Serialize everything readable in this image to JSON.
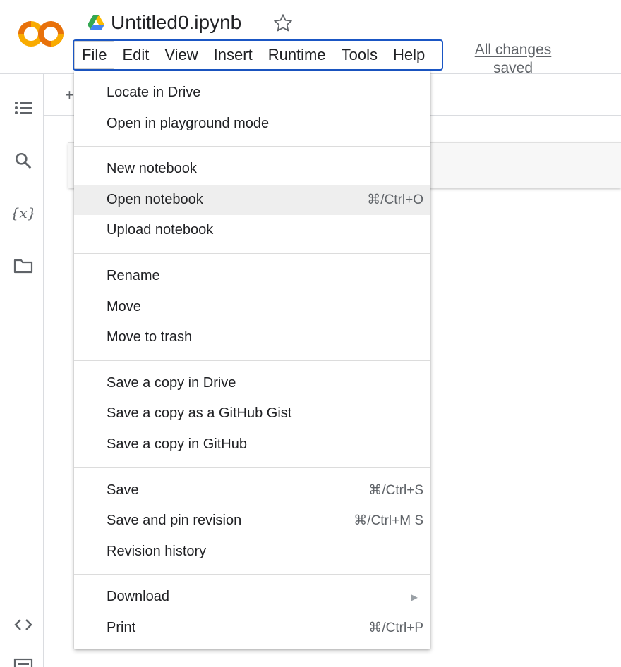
{
  "header": {
    "title": "Untitled0.ipynb",
    "save_status_line1": "All changes",
    "save_status_line2": "saved",
    "logo": {
      "text": "CO",
      "color_left": "#f9ab00",
      "color_right": "#e8710a"
    }
  },
  "menubar": {
    "items": [
      "File",
      "Edit",
      "View",
      "Insert",
      "Runtime",
      "Tools",
      "Help"
    ],
    "active": "File",
    "focus_color": "#1a56c4"
  },
  "left_rail": {
    "icons": [
      "table-of-contents-icon",
      "search-icon",
      "variables-icon",
      "folder-icon",
      "code-snippets-icon",
      "terminal-icon"
    ],
    "variables_label": "{x}"
  },
  "notebook": {
    "add_symbol": "+"
  },
  "file_menu": {
    "groups": [
      [
        {
          "label": "Locate in Drive"
        },
        {
          "label": "Open in playground mode"
        }
      ],
      [
        {
          "label": "New notebook"
        },
        {
          "label": "Open notebook",
          "shortcut": "⌘/Ctrl+O",
          "highlighted": true
        },
        {
          "label": "Upload notebook"
        }
      ],
      [
        {
          "label": "Rename"
        },
        {
          "label": "Move"
        },
        {
          "label": "Move to trash"
        }
      ],
      [
        {
          "label": "Save a copy in Drive"
        },
        {
          "label": "Save a copy as a GitHub Gist"
        },
        {
          "label": "Save a copy in GitHub"
        }
      ],
      [
        {
          "label": "Save",
          "shortcut": "⌘/Ctrl+S"
        },
        {
          "label": "Save and pin revision",
          "shortcut": "⌘/Ctrl+M S"
        },
        {
          "label": "Revision history"
        }
      ],
      [
        {
          "label": "Download",
          "submenu_arrow": "▶"
        },
        {
          "label": "Print",
          "shortcut": "⌘/Ctrl+P"
        }
      ]
    ]
  }
}
